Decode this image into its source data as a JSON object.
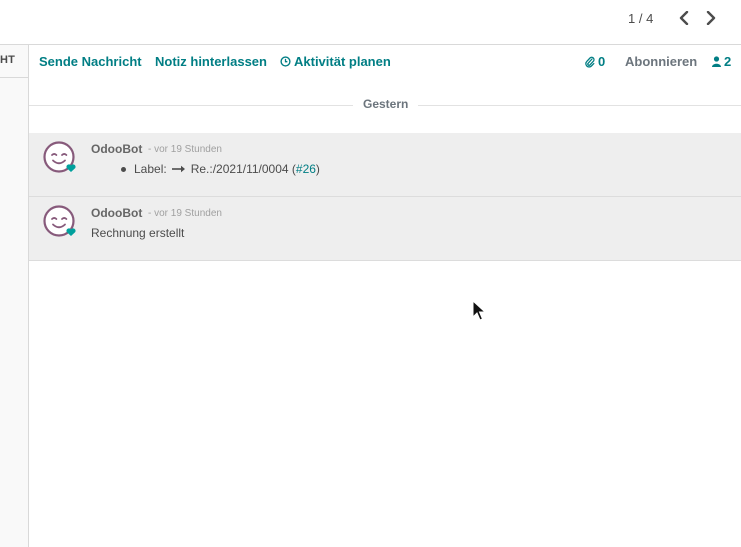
{
  "pager": {
    "value": "1 / 4"
  },
  "left_strip": {
    "label": "HT"
  },
  "chatter": {
    "send_message": "Sende Nachricht",
    "log_note": "Notiz hinterlassen",
    "schedule_activity": "Aktivität planen",
    "attachments_count": "0",
    "follow": "Abonnieren",
    "followers_count": "2"
  },
  "date_separator": "Gestern",
  "messages": [
    {
      "author": "OdooBot",
      "date": "- vor 19 Stunden",
      "tracking": {
        "field": "Label:",
        "new_value": "Re.:/2021/11/0004 (",
        "ref": "#26",
        "suffix": ")"
      }
    },
    {
      "author": "OdooBot",
      "date": "- vor 19 Stunden",
      "body": "Rechnung erstellt"
    }
  ],
  "colors": {
    "accent": "#017e84",
    "avatar_face": "#875a7b",
    "avatar_status": "#00a09d",
    "message_bg": "#eeeeee"
  },
  "icons": {
    "prev": "chevron-left-icon",
    "next": "chevron-right-icon",
    "activity": "clock-icon",
    "attachment": "paperclip-icon",
    "followers": "user-icon",
    "tracking_arrow": "long-arrow-right-icon",
    "cursor": "mouse-pointer-icon"
  }
}
